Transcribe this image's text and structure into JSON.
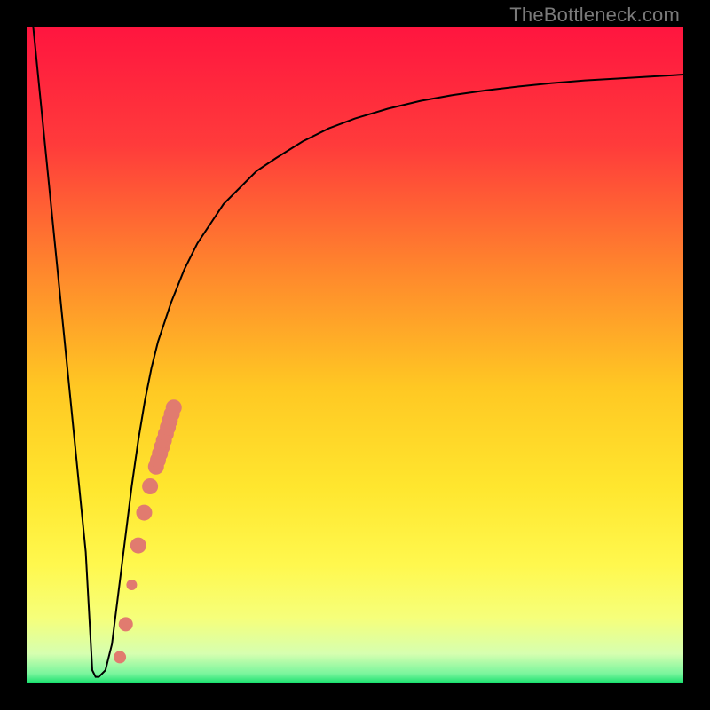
{
  "watermark": "TheBottleneck.com",
  "chart_data": {
    "type": "line",
    "title": "",
    "xlabel": "",
    "ylabel": "",
    "xlim": [
      0,
      100
    ],
    "ylim": [
      0,
      100
    ],
    "grid": false,
    "legend": false,
    "gradient_stops": [
      {
        "offset": 0.0,
        "color": "#ff153f"
      },
      {
        "offset": 0.18,
        "color": "#ff3b3b"
      },
      {
        "offset": 0.38,
        "color": "#ff8a2c"
      },
      {
        "offset": 0.55,
        "color": "#ffc823"
      },
      {
        "offset": 0.7,
        "color": "#ffe62e"
      },
      {
        "offset": 0.82,
        "color": "#fff84e"
      },
      {
        "offset": 0.9,
        "color": "#f6ff7a"
      },
      {
        "offset": 0.955,
        "color": "#d6ffb0"
      },
      {
        "offset": 0.985,
        "color": "#7af59d"
      },
      {
        "offset": 1.0,
        "color": "#18e06e"
      }
    ],
    "series": [
      {
        "name": "bottleneck-curve",
        "x": [
          1,
          2,
          3,
          4,
          5,
          6,
          7,
          8,
          9,
          10,
          10.5,
          11,
          12,
          13,
          14,
          15,
          16,
          17,
          18,
          19,
          20,
          22,
          24,
          26,
          28,
          30,
          32,
          35,
          38,
          42,
          46,
          50,
          55,
          60,
          65,
          70,
          75,
          80,
          85,
          90,
          95,
          100
        ],
        "values": [
          100,
          90,
          80,
          70,
          60,
          50,
          40,
          30,
          20,
          2,
          1,
          1,
          2,
          6,
          14,
          22,
          30,
          37,
          43,
          48,
          52,
          58,
          63,
          67,
          70,
          73,
          75,
          78,
          80,
          82.5,
          84.5,
          86,
          87.5,
          88.7,
          89.6,
          90.3,
          90.9,
          91.4,
          91.8,
          92.1,
          92.4,
          92.7
        ]
      }
    ],
    "points": {
      "name": "highlight-dots",
      "color": "#e17b6f",
      "x": [
        14.2,
        15.1,
        16.0,
        17.0,
        17.9,
        18.8,
        19.7,
        20.0,
        20.3,
        20.6,
        20.9,
        21.2,
        21.5,
        21.8,
        22.1,
        22.4
      ],
      "values": [
        4,
        9,
        15,
        21,
        26,
        30,
        33,
        34,
        35,
        36,
        37,
        38,
        39,
        40,
        41,
        42
      ],
      "radii": [
        7,
        8,
        6,
        9,
        9,
        9,
        9,
        9,
        9,
        9,
        9,
        9,
        9,
        9,
        9,
        9
      ]
    }
  }
}
